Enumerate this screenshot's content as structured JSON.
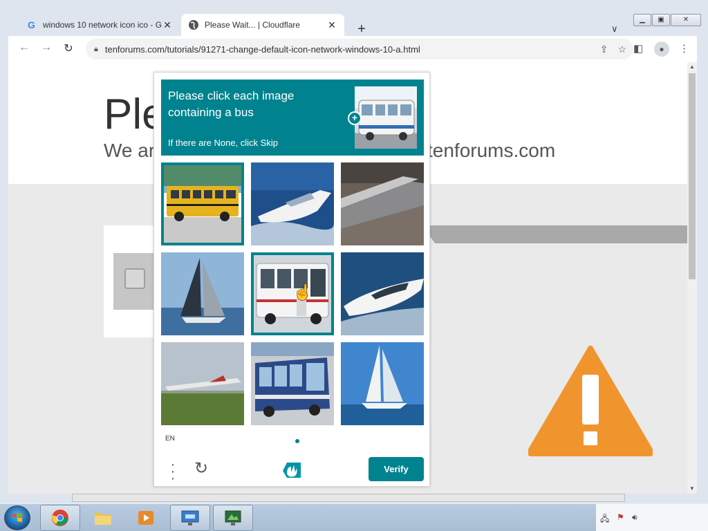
{
  "browser": {
    "tabs": [
      {
        "title": "windows 10 network icon ico - G",
        "favicon": "google-icon",
        "active": false
      },
      {
        "title": "Please Wait... | Cloudflare",
        "favicon": "globe-icon",
        "active": true
      }
    ],
    "new_tab_icon": "+",
    "tab_search_icon": "∨",
    "url": "tenforums.com/tutorials/91271-change-default-icon-network-windows-10-a.html"
  },
  "page": {
    "title_partial": "Ple",
    "subtitle_left": "We ar",
    "subtitle_right": "tenforums.com"
  },
  "captcha": {
    "prompt_title": "Please click each image containing a bus",
    "prompt_subtitle": "If there are None, click Skip",
    "language": "EN",
    "verify_label": "Verify",
    "accent": "#00838f",
    "tiles": [
      {
        "subject": "yellow school bus",
        "selected": true
      },
      {
        "subject": "motor yacht",
        "selected": false
      },
      {
        "subject": "train",
        "selected": false
      },
      {
        "subject": "sailboat",
        "selected": false
      },
      {
        "subject": "white bus",
        "selected": true
      },
      {
        "subject": "speedboat",
        "selected": false
      },
      {
        "subject": "airplane",
        "selected": false
      },
      {
        "subject": "city bus",
        "selected": false
      },
      {
        "subject": "sailboat",
        "selected": false
      }
    ]
  },
  "colors": {
    "warning": "#f0952e",
    "scroll_band": "#a9a9a9"
  }
}
